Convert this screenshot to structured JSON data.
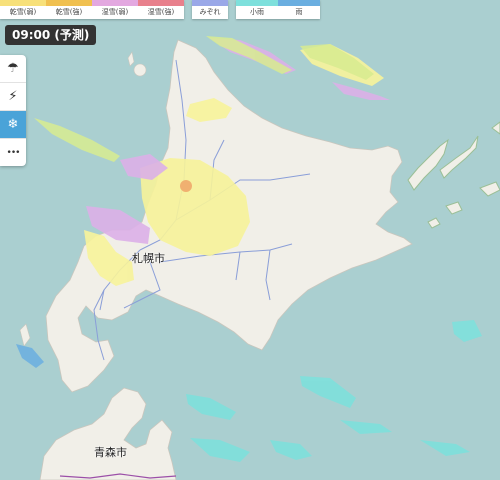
{
  "legend": {
    "group1": [
      {
        "label": "乾雪(弱)",
        "color": "#f7e07a"
      },
      {
        "label": "乾雪(強)",
        "color": "#f0c050"
      },
      {
        "label": "湿雪(弱)",
        "color": "#e3a8e0"
      },
      {
        "label": "湿雪(強)",
        "color": "#e8808c"
      }
    ],
    "group2": [
      {
        "label": "みぞれ",
        "color": "#9aa8e8"
      }
    ],
    "group3": [
      {
        "label": "小雨",
        "color": "#7ee0dc"
      },
      {
        "label": "雨",
        "color": "#6aaee0"
      }
    ]
  },
  "time_badge": "09:00 (予測)",
  "toolbar": {
    "buttons": [
      {
        "name": "rain-cloud",
        "glyph": "☂",
        "active": false
      },
      {
        "name": "lightning",
        "glyph": "⚡",
        "active": false
      },
      {
        "name": "snow",
        "glyph": "❄",
        "active": true
      },
      {
        "name": "more",
        "glyph": "•••",
        "active": false
      }
    ]
  },
  "cities": {
    "sapporo": "札幌市",
    "aomori": "青森市"
  },
  "colors": {
    "sea": "#aacfd0",
    "land": "#f1efe8",
    "dry_snow_weak": "#f7f39a",
    "wet_snow_weak": "#dcb0e8",
    "light_rain": "#7ee0dc",
    "rain": "#6aaee0",
    "sleet": "#9aa8e8"
  }
}
